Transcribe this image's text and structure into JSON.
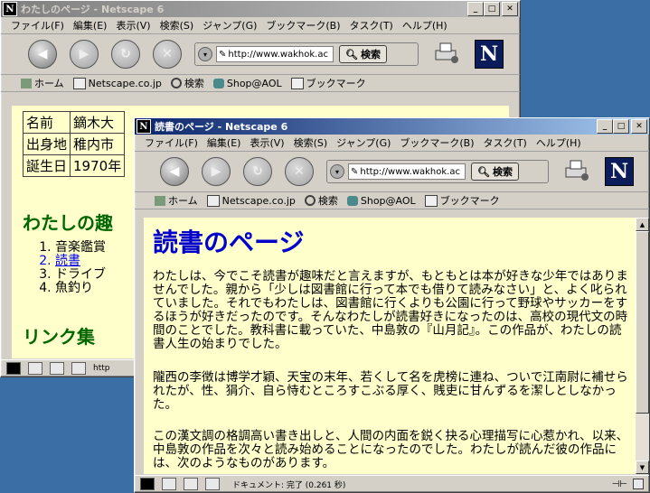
{
  "back_window": {
    "title": "わたしのページ - Netscape 6",
    "menu": [
      "ファイル(F)",
      "編集(E)",
      "表示(V)",
      "検索(S)",
      "ジャンプ(G)",
      "ブックマーク(B)",
      "タスク(T)",
      "ヘルプ(H)"
    ],
    "url": "http://www.wakhok.ac",
    "search_label": "検索",
    "personal": [
      "ホーム",
      "Netscape.co.jp",
      "検索",
      "Shop@AOL",
      "ブックマーク"
    ],
    "table": [
      {
        "label": "名前",
        "value": "鏑木大"
      },
      {
        "label": "出身地",
        "value": "稚内市"
      },
      {
        "label": "誕生日",
        "value": "1970年"
      }
    ],
    "hobby_heading": "わたしの趣",
    "hobbies": [
      "音楽鑑賞",
      "読書",
      "ドライブ",
      "魚釣り"
    ],
    "links_heading": "リンク集",
    "status": "http"
  },
  "front_window": {
    "title": "読書のページ - Netscape 6",
    "menu": [
      "ファイル(F)",
      "編集(E)",
      "表示(V)",
      "検索(S)",
      "ジャンプ(G)",
      "ブックマーク(B)",
      "タスク(T)",
      "ヘルプ(H)"
    ],
    "url": "http://www.wakhok.ac",
    "search_label": "検索",
    "personal": [
      "ホーム",
      "Netscape.co.jp",
      "検索",
      "Shop@AOL",
      "ブックマーク"
    ],
    "heading": "読書のページ",
    "paragraphs": [
      "わたしは、今でこそ読書が趣味だと言えますが、もともとは本が好きな少年ではありませんでした。親から「少しは図書館に行って本でも借りて読みなさい」と、よく叱られていました。それでもわたしは、図書館に行くよりも公園に行って野球やサッカーをするほうが好きだったのです。そんなわたしが読書好きになったのは、高校の現代文の時間のことでした。教科書に載っていた、中島敦の『山月記』。この作品が、わたしの読書人生の始まりでした。",
      "隴西の李徴は博学才穎、天宝の末年、若くして名を虎榜に連ね、ついで江南尉に補せられたが、性、狷介、自ら恃むところすこぶる厚く、賎吏に甘んずるを潔しとしなかった。",
      "この漢文調の格調高い書き出しと、人間の内面を鋭く抉る心理描写に心惹かれ、以来、中島敦の作品を次々と読み始めることになったのでした。わたしが読んだ彼の作品には、次のようなものがあります。"
    ],
    "status": "ドキュメント: 完了 (0.261 秒)"
  },
  "colors": {
    "desktop": "#3a6ea5",
    "page_bg": "#ffffcc",
    "heading_blue": "#0000cc",
    "heading_green": "#006600",
    "link": "#0000ee"
  }
}
